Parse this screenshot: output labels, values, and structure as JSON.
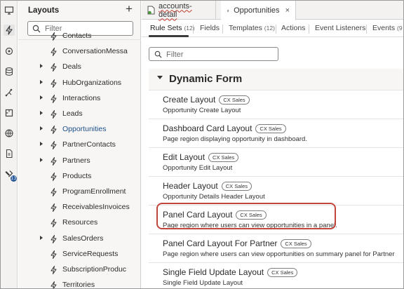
{
  "activity_bar": {
    "icons": [
      "monitor-icon",
      "bolt-icon",
      "business-object-icon",
      "database-icon",
      "process-icon",
      "component-icon",
      "globe-icon",
      "document-icon",
      "tools-icon"
    ],
    "badge": "13"
  },
  "navigator": {
    "title": "Layouts",
    "add_label": "+",
    "search_placeholder": "Filter",
    "items": [
      {
        "label": "Contacts",
        "expandable": false
      },
      {
        "label": "ConversationMessa",
        "expandable": false
      },
      {
        "label": "Deals",
        "expandable": true
      },
      {
        "label": "HubOrganizations",
        "expandable": true
      },
      {
        "label": "Interactions",
        "expandable": true
      },
      {
        "label": "Leads",
        "expandable": true
      },
      {
        "label": "Opportunities",
        "expandable": true,
        "selected": true
      },
      {
        "label": "PartnerContacts",
        "expandable": true
      },
      {
        "label": "Partners",
        "expandable": true
      },
      {
        "label": "Products",
        "expandable": false
      },
      {
        "label": "ProgramEnrollment",
        "expandable": false
      },
      {
        "label": "ReceivablesInvoices",
        "expandable": false
      },
      {
        "label": "Resources",
        "expandable": false
      },
      {
        "label": "SalesOrders",
        "expandable": true
      },
      {
        "label": "ServiceRequests",
        "expandable": false
      },
      {
        "label": "SubscriptionProduc",
        "expandable": false
      },
      {
        "label": "Territories",
        "expandable": false
      }
    ]
  },
  "editor_tabs": [
    {
      "label": "accounts-detail",
      "close": "×"
    },
    {
      "label": "Opportunities",
      "close": "×"
    }
  ],
  "sub_tabs": {
    "rule_sets": {
      "label": "Rule Sets",
      "count": "(12)"
    },
    "fields": {
      "label": "Fields"
    },
    "templates": {
      "label": "Templates",
      "count": "(12)"
    },
    "actions": {
      "label": "Actions"
    },
    "event_listeners": {
      "label": "Event Listeners"
    },
    "events": {
      "label": "Events",
      "count": "(9"
    }
  },
  "filter": {
    "placeholder": "Filter"
  },
  "group": {
    "title": "Dynamic Form"
  },
  "layouts": [
    {
      "title": "Create Layout",
      "badge": "CX Sales",
      "desc": "Opportunity Create Layout"
    },
    {
      "title": "Dashboard Card Layout",
      "badge": "CX Sales",
      "desc": "Page region displaying opportunity in dashboard."
    },
    {
      "title": "Edit Layout",
      "badge": "CX Sales",
      "desc": "Opportunity Edit Layout"
    },
    {
      "title": "Header Layout",
      "badge": "CX Sales",
      "desc": "Opportunity Details Header Layout"
    },
    {
      "title": "Panel Card Layout",
      "badge": "CX Sales",
      "desc": "Page region where users can view opportunities in a panel."
    },
    {
      "title": "Panel Card Layout For Partner",
      "badge": "CX Sales",
      "desc": "Page region where users can view opportunities on summary panel for Partner"
    },
    {
      "title": "Single Field Update Layout",
      "badge": "CX Sales",
      "desc": "Single Field Update Layout"
    }
  ],
  "colors": {
    "highlight": "#c0463c",
    "selected_text": "#1b4f8a",
    "badge_blue": "#2a5a9a"
  }
}
